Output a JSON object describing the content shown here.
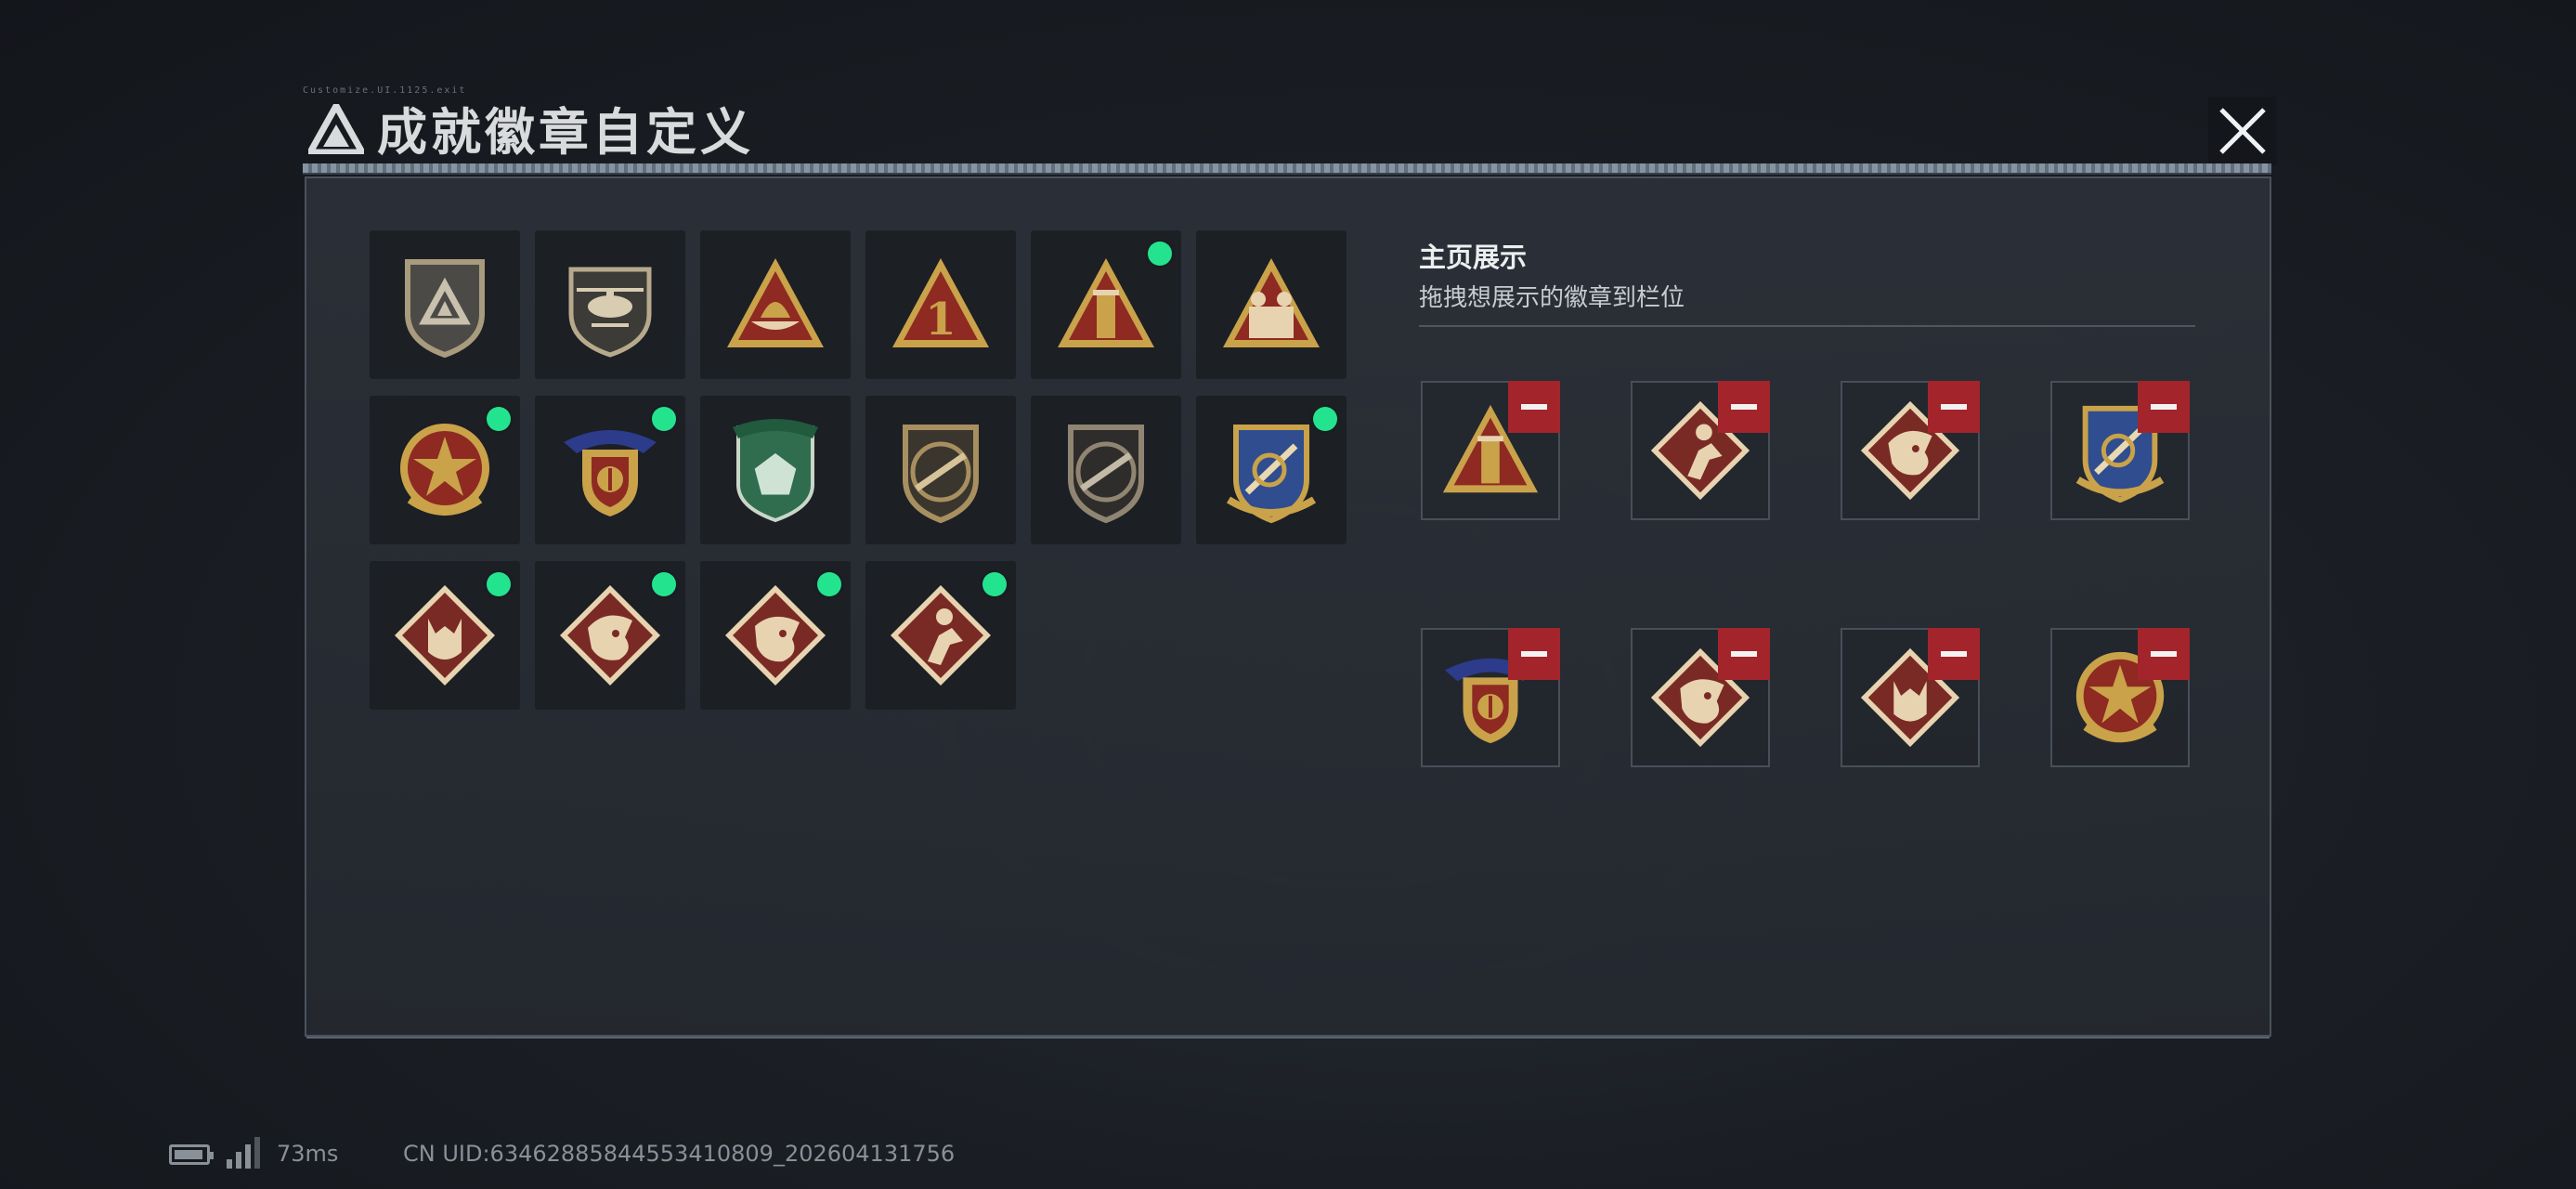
{
  "window": {
    "title": "成就徽章自定义",
    "header_small_text": "Customize.UI.1125.exit"
  },
  "badges": [
    {
      "icon": "shield-triangle-logo-badge",
      "new": false
    },
    {
      "icon": "helicopter-badge",
      "new": false
    },
    {
      "icon": "triangle-boat-badge",
      "new": false
    },
    {
      "icon": "triangle-number-one-badge",
      "new": false
    },
    {
      "icon": "triangle-tower-badge",
      "new": true
    },
    {
      "icon": "triangle-soldiers-badge",
      "new": false
    },
    {
      "icon": "star-medal-badge",
      "new": true
    },
    {
      "icon": "winged-crest-badge",
      "new": true
    },
    {
      "icon": "green-gem-badge",
      "new": false
    },
    {
      "icon": "rifle-shield-badge",
      "new": false
    },
    {
      "icon": "rifle-shield-dark-badge",
      "new": false
    },
    {
      "icon": "blue-crest-badge",
      "new": true
    },
    {
      "icon": "wolf-diamond-badge",
      "new": true
    },
    {
      "icon": "dragon-diamond-badge",
      "new": true
    },
    {
      "icon": "dragon-diamond-2-badge",
      "new": true
    },
    {
      "icon": "runner-diamond-badge",
      "new": true
    }
  ],
  "display": {
    "title": "主页展示",
    "subtitle": "拖拽想展示的徽章到栏位",
    "slots": [
      {
        "icon": "triangle-tower-badge"
      },
      {
        "icon": "runner-diamond-badge"
      },
      {
        "icon": "dragon-diamond-badge"
      },
      {
        "icon": "blue-crest-badge"
      },
      {
        "icon": "winged-crest-badge"
      },
      {
        "icon": "dragon-diamond-2-badge"
      },
      {
        "icon": "wolf-diamond-badge"
      },
      {
        "icon": "star-medal-badge"
      }
    ]
  },
  "status_bar": {
    "ping": "73ms",
    "uid": "CN UID:6346288584455341080​9_202604131756"
  },
  "colors": {
    "new_dot": "#24e38f",
    "remove_button": "#a3252b",
    "panel_bg": "#2c3038"
  }
}
